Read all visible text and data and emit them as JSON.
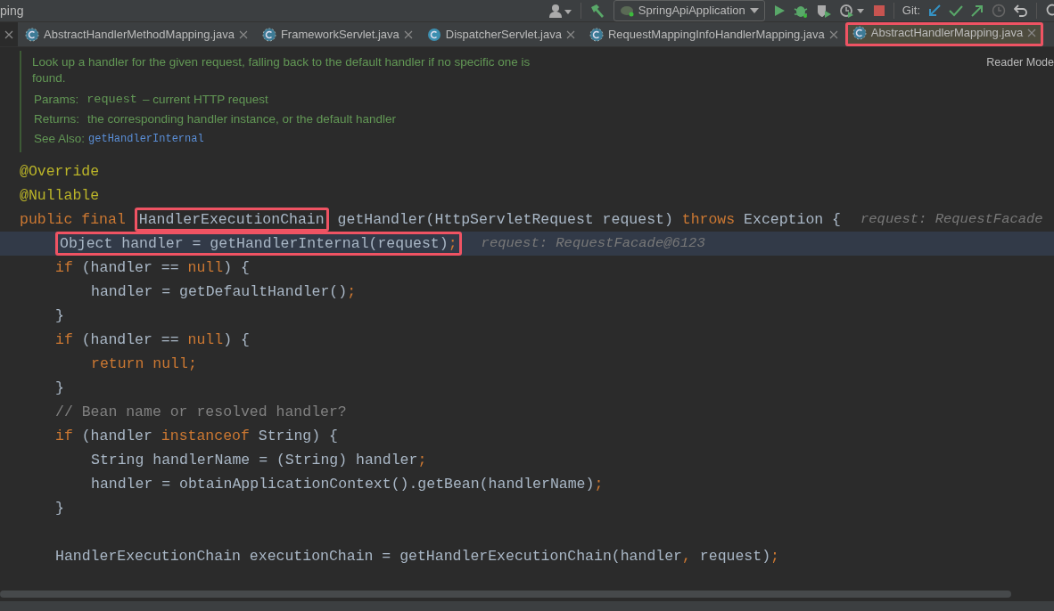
{
  "window": {
    "title": "ping"
  },
  "toolbar": {
    "run_config": "SpringApiApplication",
    "git_label": "Git:"
  },
  "tabs": [
    {
      "kind": "cut",
      "selected": false
    },
    {
      "kind": "abstract",
      "label": "AbstractHandlerMethodMapping.java",
      "selected": false,
      "highlighted": false
    },
    {
      "kind": "abstract",
      "label": "FrameworkServlet.java",
      "selected": false,
      "highlighted": false
    },
    {
      "kind": "class",
      "label": "DispatcherServlet.java",
      "selected": false,
      "highlighted": false
    },
    {
      "kind": "abstract",
      "label": "RequestMappingInfoHandlerMapping.java",
      "selected": false,
      "highlighted": false
    },
    {
      "kind": "abstract",
      "label": "AbstractHandlerMapping.java",
      "selected": true,
      "highlighted": true
    }
  ],
  "reader_mode": "Reader Mode",
  "doc": {
    "description": "Look up a handler for the given request, falling back to the default handler if no specific one is found.",
    "params_label": "Params:",
    "param_name": "request",
    "param_text": "– current HTTP request",
    "returns_label": "Returns:",
    "returns_text": "the corresponding handler instance, or the default handler",
    "see_label": "See Also:",
    "see_link": "getHandlerInternal"
  },
  "code": [
    {
      "kind": "line",
      "tokens": [
        {
          "kind": "ann",
          "text": "@Override"
        }
      ]
    },
    {
      "kind": "line",
      "tokens": [
        {
          "kind": "ann",
          "text": "@Nullable"
        }
      ]
    },
    {
      "kind": "line",
      "tokens": [
        {
          "kind": "kw",
          "text": "public final "
        },
        {
          "kind": "box",
          "tokens": [
            {
              "kind": "plain",
              "text": "HandlerExecutionChain"
            }
          ]
        },
        {
          "kind": "plain",
          "text": " getHandler(HttpServletRequest request) "
        },
        {
          "kind": "kw",
          "text": "throws"
        },
        {
          "kind": "plain",
          "text": " Exception {"
        },
        {
          "kind": "hint",
          "text": "request: RequestFacade"
        }
      ],
      "children": [
        {
          "kind": "line",
          "current": true,
          "tokens": [
            {
              "kind": "box",
              "tokens": [
                {
                  "kind": "plain",
                  "text": "Object handler = getHandlerInternal(request)"
                },
                {
                  "kind": "kw",
                  "text": ";"
                }
              ]
            },
            {
              "kind": "hint",
              "text": "request: RequestFacade@6123"
            }
          ]
        },
        {
          "kind": "line",
          "tokens": [
            {
              "kind": "kw",
              "text": "if"
            },
            {
              "kind": "plain",
              "text": " (handler == "
            },
            {
              "kind": "kw",
              "text": "null"
            },
            {
              "kind": "plain",
              "text": ") {"
            }
          ],
          "children": [
            {
              "kind": "line",
              "tokens": [
                {
                  "kind": "plain",
                  "text": "handler = getDefaultHandler()"
                },
                {
                  "kind": "kw",
                  "text": ";"
                }
              ]
            }
          ]
        },
        {
          "kind": "line",
          "tokens": [
            {
              "kind": "plain",
              "text": "}"
            }
          ]
        },
        {
          "kind": "line",
          "tokens": [
            {
              "kind": "kw",
              "text": "if"
            },
            {
              "kind": "plain",
              "text": " (handler == "
            },
            {
              "kind": "kw",
              "text": "null"
            },
            {
              "kind": "plain",
              "text": ") {"
            }
          ],
          "children": [
            {
              "kind": "line",
              "tokens": [
                {
                  "kind": "kw",
                  "text": "return null;"
                }
              ]
            }
          ]
        },
        {
          "kind": "line",
          "tokens": [
            {
              "kind": "plain",
              "text": "}"
            }
          ]
        },
        {
          "kind": "line",
          "tokens": [
            {
              "kind": "comment",
              "text": "// Bean name or resolved handler?"
            }
          ]
        },
        {
          "kind": "line",
          "tokens": [
            {
              "kind": "kw",
              "text": "if"
            },
            {
              "kind": "plain",
              "text": " (handler "
            },
            {
              "kind": "kw",
              "text": "instanceof"
            },
            {
              "kind": "plain",
              "text": " String) {"
            }
          ],
          "children": [
            {
              "kind": "line",
              "tokens": [
                {
                  "kind": "plain",
                  "text": "String handlerName = (String) handler"
                },
                {
                  "kind": "kw",
                  "text": ";"
                }
              ]
            },
            {
              "kind": "line",
              "tokens": [
                {
                  "kind": "plain",
                  "text": "handler = obtainApplicationContext().getBean(handlerName)"
                },
                {
                  "kind": "kw",
                  "text": ";"
                }
              ]
            }
          ]
        },
        {
          "kind": "line",
          "tokens": [
            {
              "kind": "plain",
              "text": "}"
            }
          ]
        },
        {
          "kind": "blank"
        },
        {
          "kind": "line",
          "tokens": [
            {
              "kind": "plain",
              "text": "HandlerExecutionChain executionChain = getHandlerExecutionChain(handler"
            },
            {
              "kind": "kw",
              "text": ","
            },
            {
              "kind": "plain",
              "text": " request)"
            },
            {
              "kind": "kw",
              "text": ";"
            }
          ]
        }
      ]
    }
  ]
}
